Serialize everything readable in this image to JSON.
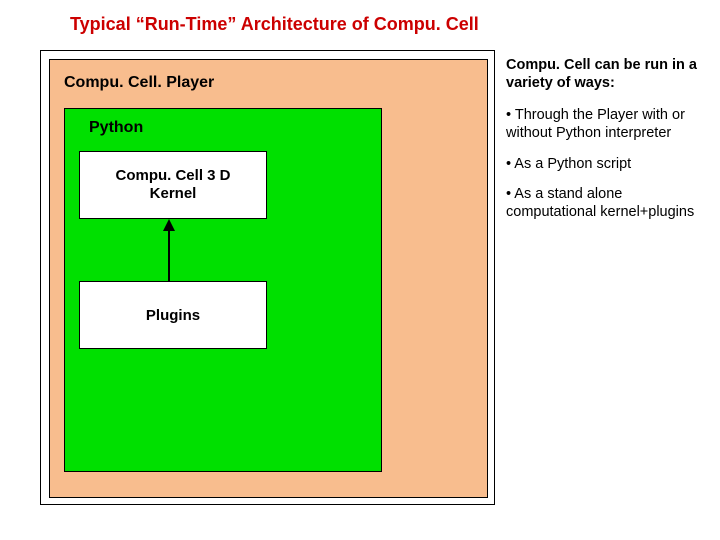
{
  "title": "Typical “Run-Time” Architecture of Compu. Cell",
  "diagram": {
    "player_label": "Compu. Cell. Player",
    "python_label": "Python",
    "kernel_label": "Compu. Cell 3 D\nKernel",
    "plugins_label": "Plugins"
  },
  "side": {
    "heading": "Compu. Cell can be run in a variety of ways:",
    "bullets": [
      "• Through the Player with or without Python interpreter",
      "• As a Python script",
      "• As a stand alone computational kernel+plugins"
    ]
  }
}
